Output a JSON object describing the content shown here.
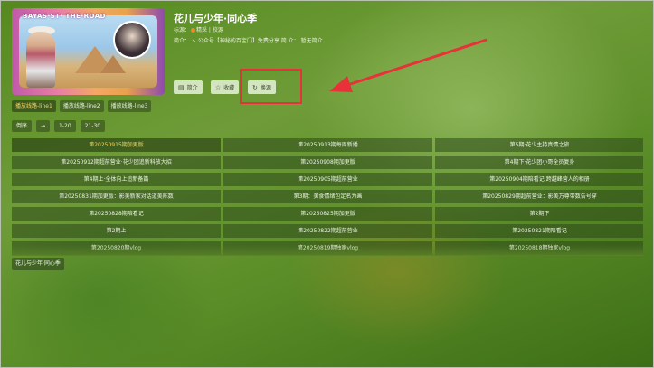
{
  "poster": {
    "overlay_text": "BAYAS·ST· THE·ROAD"
  },
  "show": {
    "title": "花儿与少年·同心季",
    "meta_line1_prefix": "标源：",
    "meta_line1_source": "精采 | 校源",
    "meta_line2": "简介：  ↘ 公众号【神秘的百宝门】免费分享   简 介：  暂无简介"
  },
  "buttons": {
    "intro": "简介",
    "favorite": "收藏",
    "switch_source": "换源"
  },
  "lines": [
    "播放线路-line1",
    "播放线路-line2",
    "播放线路-line3"
  ],
  "controls": {
    "order": "倒序",
    "arrow": "→",
    "range1": "1-20",
    "range2": "21-30"
  },
  "episodes": [
    "第20250915期加更版",
    "第20250913期每周新播",
    "第5期·花少主持真情之旅",
    "第20250912期超前营业·花少团追新科放大招",
    "第20250908期加更版",
    "第4期下·花少团小哥全员复身",
    "第4期上·全体向上追新备篇",
    "第20250905期超前营业",
    "第20250904期陪看记·跨越峰营人的相册",
    "第20250831期加更版：影美新家对话道美陈数",
    "第3期：美食情绪包定名为画",
    "第20250829期超前营业：影美万尊带数告号穿",
    "第20250828期陪看记",
    "第20250825期加更版",
    "第2期下",
    "第2期上",
    "第20250822期超前营业",
    "第20250821期陪看记",
    "第20250820期vlog",
    "第20250819期独家vlog",
    "第20250818期独家vlog"
  ],
  "season_tag": "花儿与少年·同心季",
  "colors": {
    "highlight_box": "#e8323a",
    "active_text": "#f2d45c"
  }
}
